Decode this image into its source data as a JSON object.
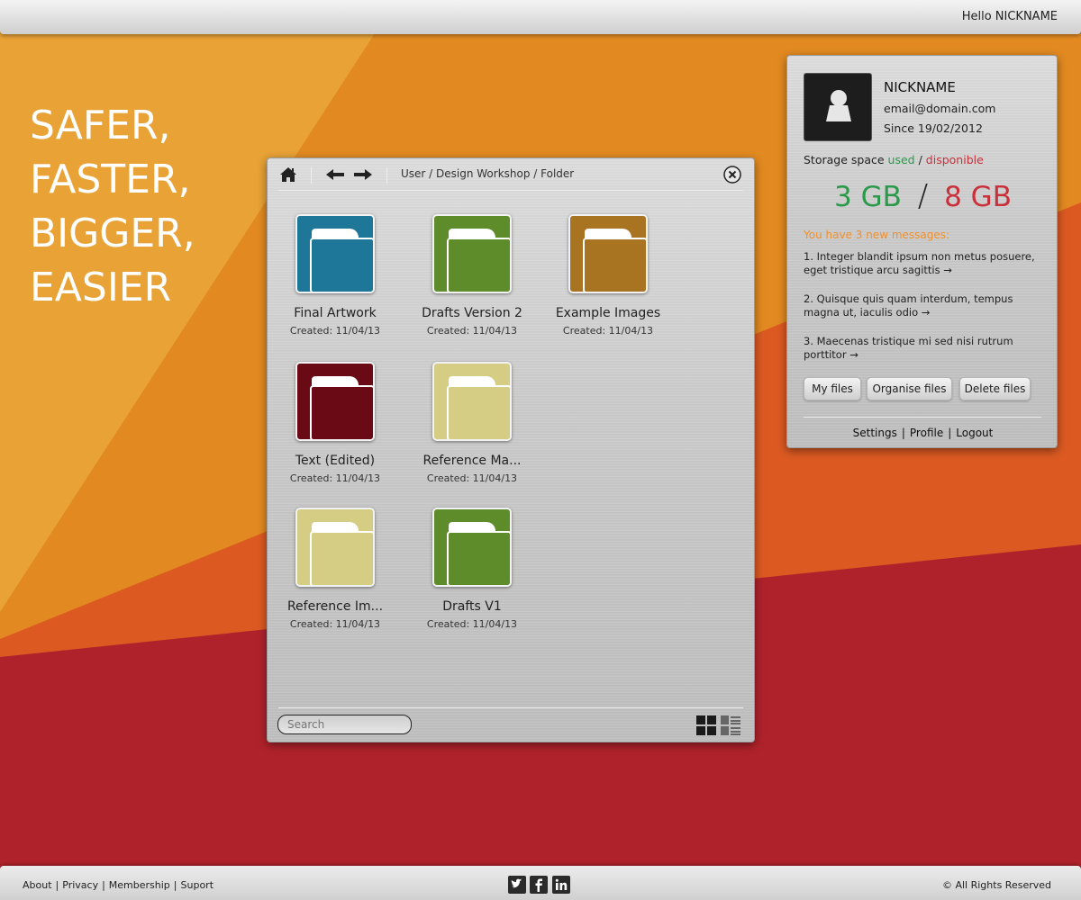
{
  "header": {
    "greeting": "Hello NICKNAME"
  },
  "slogan": [
    "SAFER,",
    "FASTER,",
    "BIGGER,",
    "EASIER"
  ],
  "explorer": {
    "breadcrumb": "User / Design Workshop / Folder",
    "folders": [
      {
        "name": "Final Artwork",
        "created": "Created: 11/04/13",
        "color": "#1e7699"
      },
      {
        "name": "Drafts Version 2",
        "created": "Created: 11/04/13",
        "color": "#5f8c2a"
      },
      {
        "name": "Example Images",
        "created": "Created: 11/04/13",
        "color": "#a87421"
      },
      {
        "name": "Text (Edited)",
        "created": "Created: 11/04/13",
        "color": "#6a0a14"
      },
      {
        "name": "Reference Ma...",
        "created": "Created: 11/04/13",
        "color": "#d6cd84"
      },
      {
        "name": "Reference Im...",
        "created": "Created: 11/04/13",
        "color": "#d6cd84"
      },
      {
        "name": "Drafts V1",
        "created": "Created: 11/04/13",
        "color": "#5f8c2a"
      }
    ],
    "search_placeholder": "Search"
  },
  "profile": {
    "nickname": "NICKNAME",
    "email": "email@domain.com",
    "since": "Since 19/02/2012",
    "storage_label": "Storage space",
    "storage_used_label": "used",
    "storage_sep": "/",
    "storage_disponible_label": "disponible",
    "used": "3 GB",
    "total": "8 GB",
    "new_messages": "You have 3 new messages:",
    "messages": [
      "1. Integer blandit ipsum non metus posuere, eget tristique arcu sagittis →",
      "2. Quisque quis quam interdum, tempus magna ut, iaculis odio →",
      "3. Maecenas tristique mi sed nisi rutrum porttitor →"
    ],
    "buttons": {
      "my_files": "My files",
      "organise_files": "Organise files",
      "delete_files": "Delete files"
    },
    "links": {
      "settings": "Settings",
      "profile": "Profile",
      "logout": "Logout"
    }
  },
  "footer": {
    "links": {
      "about": "About",
      "privacy": "Privacy",
      "membership": "Membership",
      "support": "Suport"
    },
    "copyright": "©  All Rights Reserved"
  },
  "colors": {
    "bg_light_orange": "#e8a236",
    "bg_orange": "#e28a21",
    "bg_dark_orange": "#dc5a22",
    "bg_red": "#b0222b",
    "used_green": "#2a9a4a",
    "total_red": "#c9303a",
    "message_orange": "#f0902c"
  },
  "icons": {
    "home": "home-icon",
    "back": "arrow-left-icon",
    "forward": "arrow-right-icon",
    "close": "close-icon",
    "grid_view": "grid-view-icon",
    "list_view": "list-view-icon",
    "user": "user-icon",
    "twitter": "twitter-icon",
    "facebook": "facebook-icon",
    "linkedin": "linkedin-icon"
  }
}
